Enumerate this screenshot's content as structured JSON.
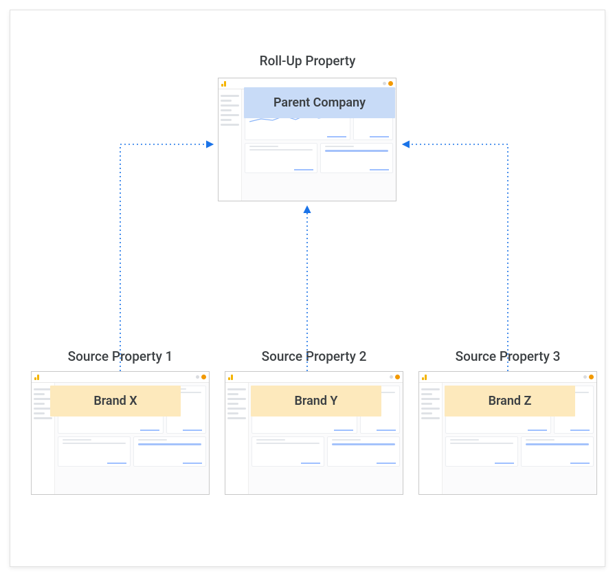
{
  "titles": {
    "rollup": "Roll-Up Property",
    "source1": "Source Property 1",
    "source2": "Source Property 2",
    "source3": "Source Property 3"
  },
  "chips": {
    "parent": "Parent Company",
    "brand_x": "Brand  X",
    "brand_y": "Brand Y",
    "brand_z": "Brand Z"
  },
  "colors": {
    "parent_chip_bg": "#c8dbf7",
    "brand_chip_bg": "#fde9bc",
    "connector": "#1a73e8"
  }
}
